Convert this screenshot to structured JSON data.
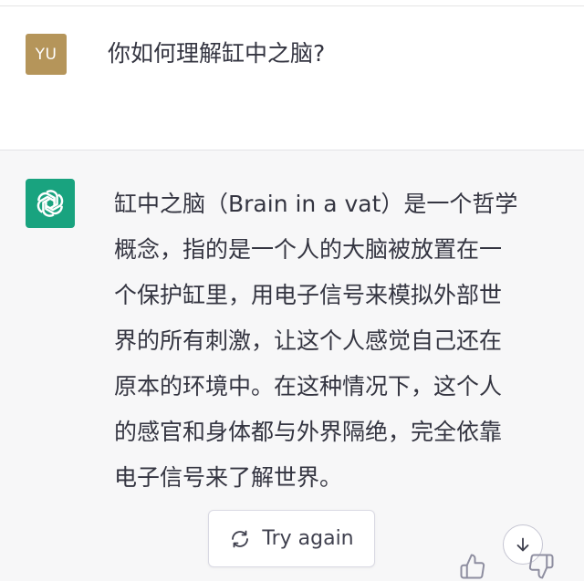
{
  "user": {
    "avatar_text": "YU",
    "avatar_color": "#b5955a",
    "message": "你如何理解缸中之脑?"
  },
  "assistant": {
    "avatar_icon": "openai-logo-icon",
    "avatar_color": "#19a37f",
    "lines": [
      "缸中之脑（Brain in a vat）是一个哲学",
      "概念，指的是一个人的大脑被放置在一",
      "个保护缸里，用电子信号来模拟外部世",
      "界的所有刺激，让这个人感觉自己还在",
      "原本的环境中。在这种情况下，这个人",
      "的感官和身体都与外界隔绝，完全依靠",
      "电子信号来了解世界。"
    ]
  },
  "controls": {
    "try_again_label": "Try again",
    "try_again_icon": "refresh-icon",
    "scroll_icon": "arrow-down-icon",
    "thumbs_up_icon": "thumbs-up-icon",
    "thumbs_down_icon": "thumbs-down-icon"
  }
}
